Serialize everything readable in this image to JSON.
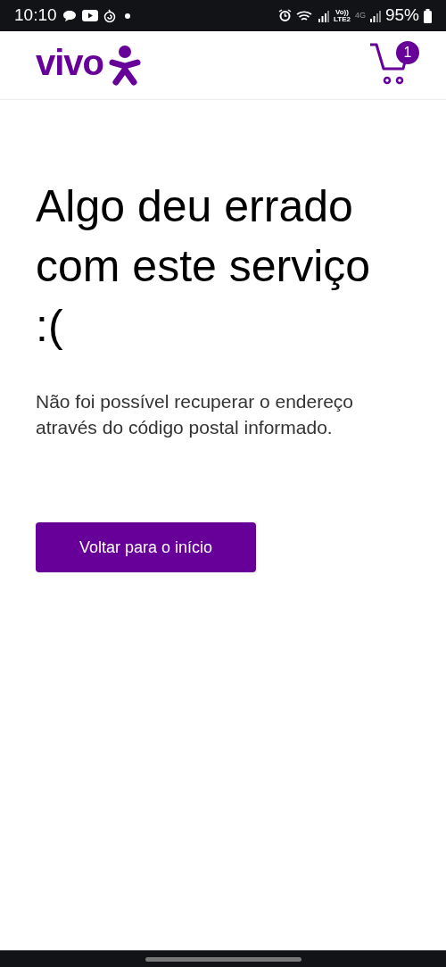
{
  "status_bar": {
    "time": "10:10",
    "network_top": "Vo))",
    "network_bottom": "LTE2",
    "network_type": "4G",
    "battery": "95%"
  },
  "header": {
    "logo": "vivo",
    "cart_count": "1"
  },
  "error": {
    "title": "Algo deu errado com este serviço :(",
    "message": "Não foi possível recuperar o endereço através do código postal informado.",
    "button": "Voltar para o início"
  }
}
